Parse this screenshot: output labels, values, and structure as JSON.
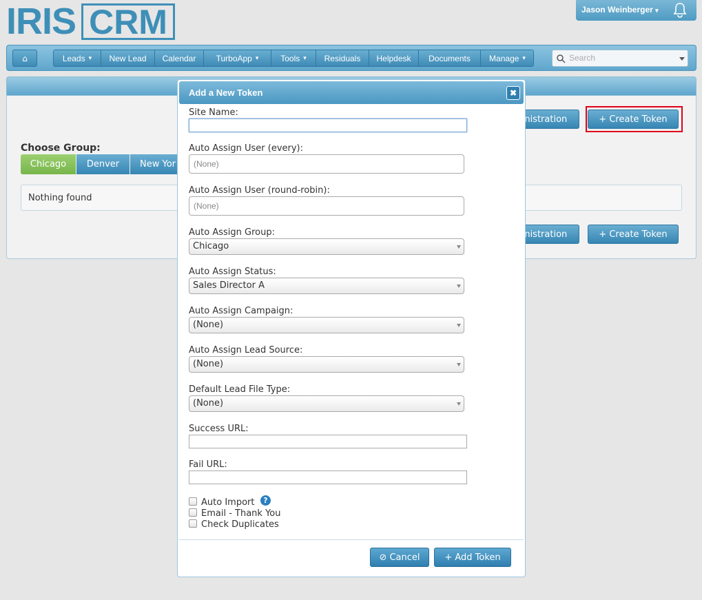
{
  "brand": {
    "logo_left": "IRIS",
    "logo_right": "CRM",
    "color": "#3e8fb8"
  },
  "user": {
    "name": "Jason Weinberger",
    "caret": "▾",
    "bell_icon": "bell-icon"
  },
  "nav": {
    "home_icon": "home-icon",
    "items": [
      {
        "label": "Leads",
        "dropdown": true
      },
      {
        "label": "New Lead",
        "dropdown": false
      },
      {
        "label": "Calendar",
        "dropdown": false
      },
      {
        "label": "TurboApp",
        "dropdown": true
      },
      {
        "label": "Tools",
        "dropdown": true
      },
      {
        "label": "Residuals",
        "dropdown": false
      },
      {
        "label": "Helpdesk",
        "dropdown": false
      },
      {
        "label": "Documents",
        "dropdown": false
      },
      {
        "label": "Manage",
        "dropdown": true
      }
    ],
    "caret": "▾",
    "search_placeholder": "Search"
  },
  "page": {
    "admin_btn": "inistration",
    "create_token": "+  Create Token",
    "choose_group": "Choose Group:",
    "groups": [
      {
        "label": "Chicago",
        "active": true
      },
      {
        "label": "Denver",
        "active": false
      },
      {
        "label": "New Yor",
        "active": false
      }
    ],
    "nothing_found": "Nothing found"
  },
  "modal": {
    "title": "Add a New Token",
    "close_icon": "✖",
    "site_name_label": "Site Name:",
    "site_name_value": "",
    "auto_user_every_label": "Auto Assign User (every):",
    "auto_user_every_placeholder": "(None)",
    "auto_user_rr_label": "Auto Assign User (round-robin):",
    "auto_user_rr_placeholder": "(None)",
    "group_label": "Auto Assign Group:",
    "group_value": "Chicago",
    "status_label": "Auto Assign Status:",
    "status_value": "Sales Director A",
    "campaign_label": "Auto Assign Campaign:",
    "campaign_value": "(None)",
    "lead_source_label": "Auto Assign Lead Source:",
    "lead_source_value": "(None)",
    "file_type_label": "Default Lead File Type:",
    "file_type_value": "(None)",
    "success_url_label": "Success URL:",
    "fail_url_label": "Fail URL:",
    "auto_import_label": "Auto Import",
    "auto_import_checked": false,
    "help_icon": "?",
    "email_thanks_label": "Email - Thank You",
    "email_thanks_checked": false,
    "check_dup_label": "Check Duplicates",
    "check_dup_checked": false,
    "cancel_label": "⊘  Cancel",
    "add_token_label": "+  Add Token"
  }
}
